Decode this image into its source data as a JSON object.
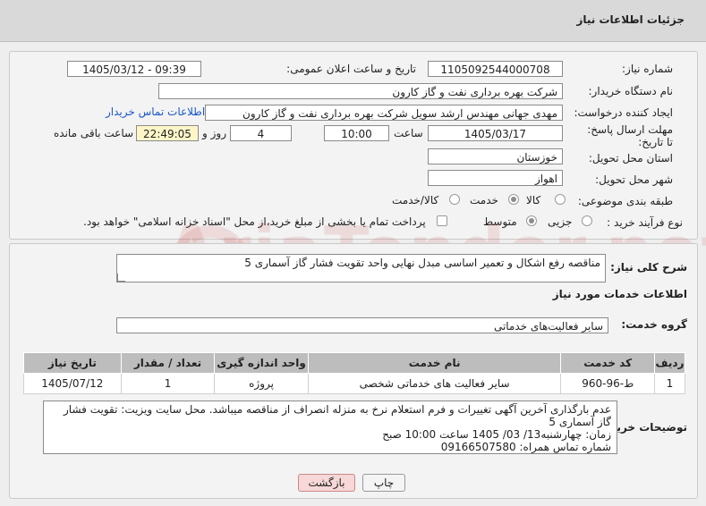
{
  "header": {
    "title": "جزئیات اطلاعات نیاز"
  },
  "form": {
    "need_number_label": "شماره نیاز:",
    "need_number": "1105092544000708",
    "announce_label": "تاریخ و ساعت اعلان عمومی:",
    "announce_value": "1405/03/12 - 09:39",
    "buyer_label": "نام دستگاه خریدار:",
    "buyer_value": "شرکت بهره برداری نفت و گاز کارون",
    "creator_label": "ایجاد کننده درخواست:",
    "creator_value": "مهدی جهانی مهندس ارشد سویل شرکت بهره برداری نفت و گاز کارون",
    "contact_link": "اطلاعات تماس خریدار",
    "deadline_label": "مهلت ارسال پاسخ: تا تاریخ:",
    "deadline_date": "1405/03/17",
    "time_label": "ساعت",
    "deadline_time": "10:00",
    "days_value": "4",
    "days_label": "روز و",
    "remaining_value": "22:49:05",
    "remaining_label": "ساعت باقی مانده",
    "province_label": "استان محل تحویل:",
    "province_value": "خوزستان",
    "city_label": "شهر محل تحویل:",
    "city_value": "اهواز",
    "category_label": "طبقه بندی موضوعی:",
    "category_options": [
      "کالا",
      "خدمت",
      "کالا/خدمت"
    ],
    "category_selected": "خدمت",
    "process_label": "نوع فرآیند خرید :",
    "process_options": [
      "جزیی",
      "متوسط"
    ],
    "process_selected": "متوسط",
    "payment_note": "پرداخت تمام یا بخشی از مبلغ خرید،از محل \"اسناد خزانه اسلامی\" خواهد بود."
  },
  "summary": {
    "label": "شرح کلی نیاز:",
    "value": "مناقصه رفع اشکال و تعمیر اساسی مبدل نهایی واحد تقویت فشار گاز آسماری 5"
  },
  "services": {
    "section_title": "اطلاعات خدمات مورد نیاز",
    "group_label": "گروه خدمت:",
    "group_value": "سایر فعالیت‌های خدماتی",
    "columns": [
      "ردیف",
      "کد خدمت",
      "نام خدمت",
      "واحد اندازه گیری",
      "تعداد / مقدار",
      "تاریخ نیاز"
    ],
    "rows": [
      [
        "1",
        "ط-96-960",
        "سایر فعالیت های خدماتی شخصی",
        "پروژه",
        "1",
        "1405/07/12"
      ]
    ]
  },
  "buyer_notes": {
    "label": "توضیحات خریدار:",
    "lines": [
      "عدم بارگذاری آخرین آگهی تغییرات و فرم استعلام نرخ  به منزله انصراف از مناقصه میباشد. محل سایت ویزیت: تقویت فشار گاز آسماری 5",
      "زمان: چهارشنبه13/ 03/ 1405 ساعت 10:00 صبح",
      "شماره تماس همراه: 09166507580"
    ]
  },
  "buttons": {
    "print": "چاپ",
    "back": "بازگشت"
  },
  "watermark": "AriaTender.net"
}
